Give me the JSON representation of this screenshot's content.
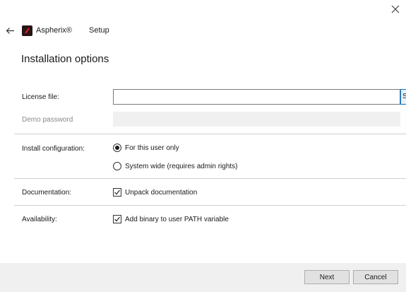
{
  "header": {
    "app_name": "Aspherix®",
    "section": "Setup",
    "close_icon": "close-icon",
    "back_icon": "arrow-left-icon",
    "logo_icon": "aspherix-logo-icon",
    "logo_color": "#2a1418",
    "logo_accent": "#e2231a"
  },
  "page": {
    "title": "Installation options"
  },
  "license": {
    "label": "License file:",
    "value": "",
    "browse_label": "S"
  },
  "demo": {
    "label": "Demo password",
    "value": ""
  },
  "install": {
    "label": "Install configuration:",
    "options": [
      {
        "label": "For this user only",
        "selected": true
      },
      {
        "label": "System wide (requires admin rights)",
        "selected": false
      }
    ]
  },
  "documentation": {
    "label": "Documentation:",
    "checkbox_label": "Unpack documentation",
    "checked": true
  },
  "availability": {
    "label": "Availability:",
    "checkbox_label": "Add binary to user PATH variable",
    "checked": true
  },
  "footer": {
    "next_label": "Next",
    "cancel_label": "Cancel"
  },
  "colors": {
    "accent": "#0078d7",
    "footer_bg": "#f0f0f0",
    "disabled_text": "#8a8a8a"
  }
}
